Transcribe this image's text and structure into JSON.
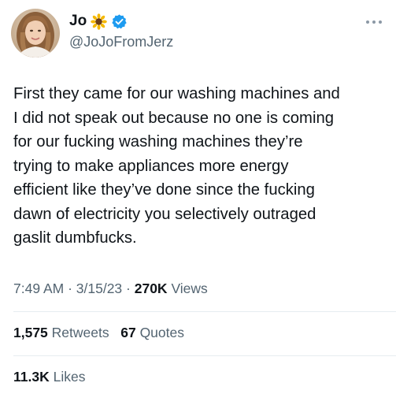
{
  "author": {
    "display_name": "Jo",
    "name_emoji": "sunflower-icon",
    "verified_badge": "verified-badge-icon",
    "handle": "@JoJoFromJerz"
  },
  "tweet": {
    "text": "First they came for our washing machines and\nI did not speak out because no one is coming\nfor our fucking washing machines they’re\ntrying to make appliances more energy\nefficient like they’ve done since the fucking\ndawn of electricity you selectively outraged\ngaslit dumbfucks."
  },
  "meta": {
    "time": "7:49 AM",
    "sep1": " · ",
    "date": "3/15/23",
    "sep2": " · ",
    "views_count": "270K",
    "views_label": " Views"
  },
  "stats": {
    "retweets_count": "1,575",
    "retweets_label": "Retweets",
    "quotes_count": "67",
    "quotes_label": "Quotes",
    "likes_count": "11.3K",
    "likes_label": "Likes"
  },
  "colors": {
    "text_primary": "#0f1419",
    "text_secondary": "#536471",
    "verified_blue": "#1d9bf0",
    "divider": "#e6ecf0"
  }
}
